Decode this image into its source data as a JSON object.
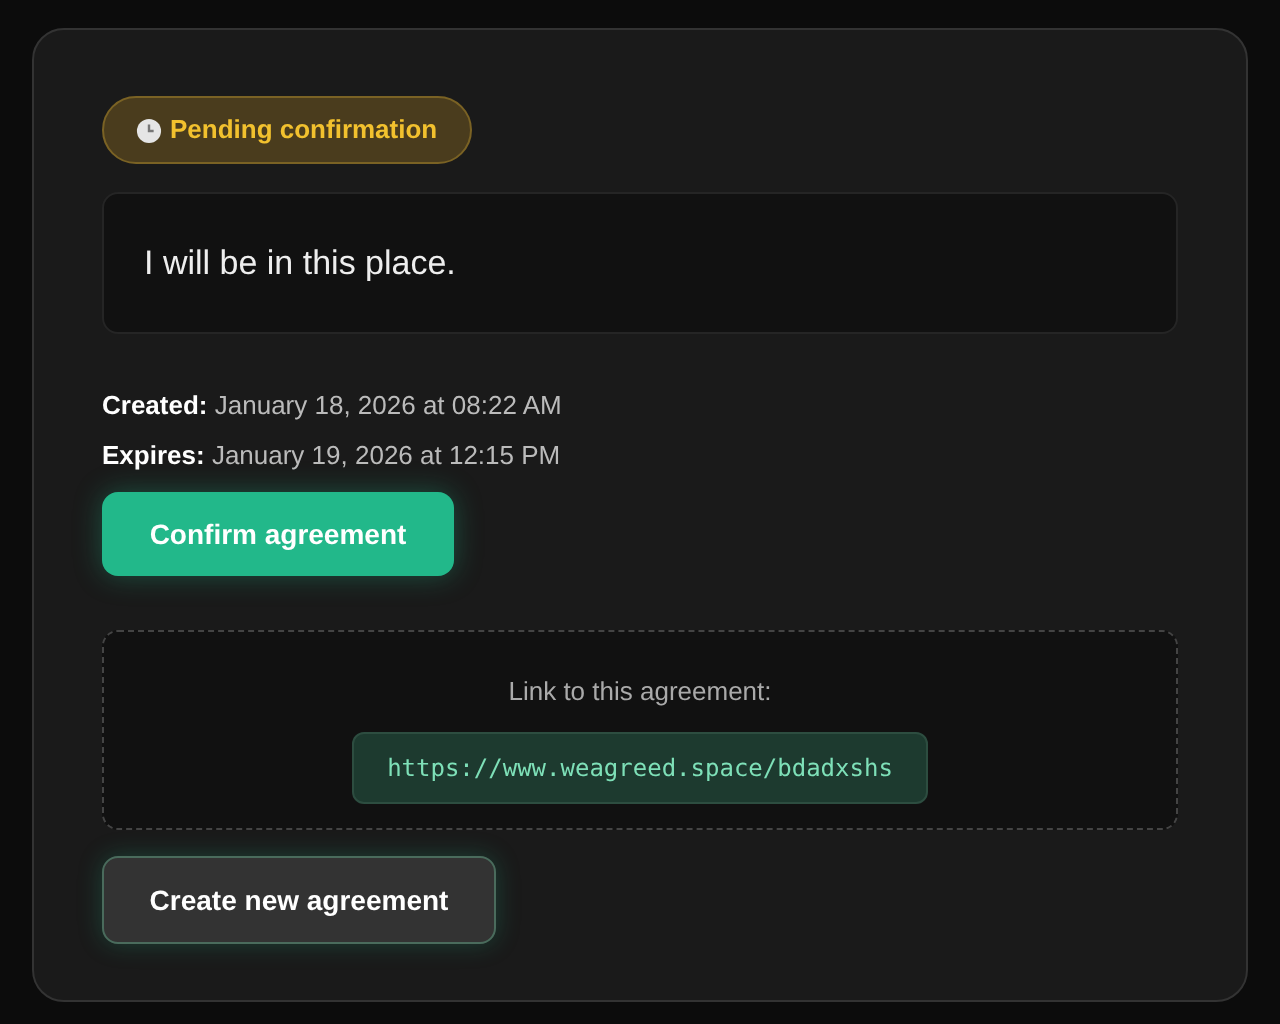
{
  "status_badge": {
    "label": "Pending confirmation"
  },
  "message": "I will be in this place.",
  "details": [
    {
      "label": "Created:",
      "value": "January 18, 2026 at 08:22 AM"
    },
    {
      "label": "Expires:",
      "value": "January 19, 2026 at 12:15 PM"
    }
  ],
  "confirm_button": "Confirm agreement",
  "link_box": {
    "label": "Link to this agreement:",
    "url": "https://www.weagreed.space/bdadxshs"
  },
  "new_button": "Create new agreement"
}
